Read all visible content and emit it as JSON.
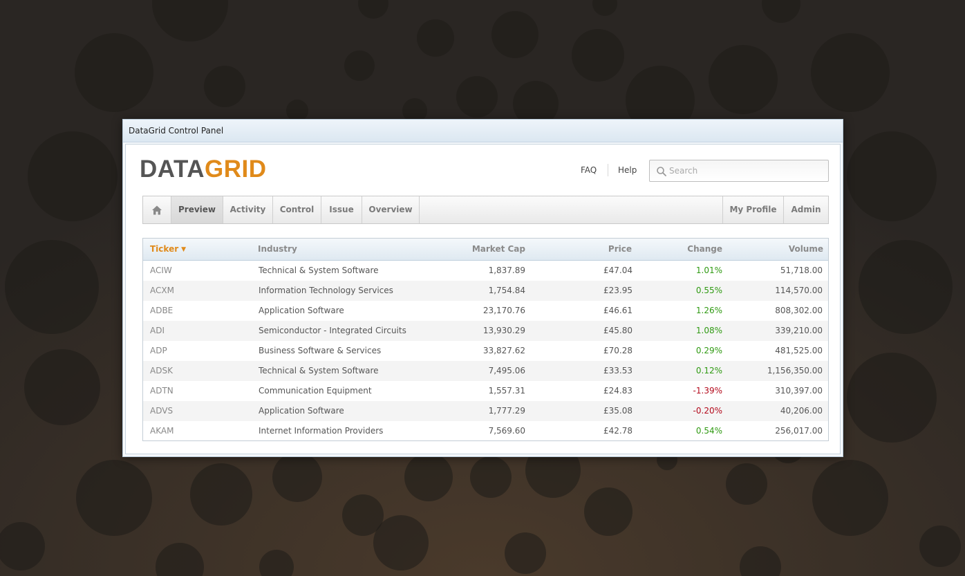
{
  "window": {
    "title": "DataGrid Control Panel"
  },
  "logo": {
    "part1": "DATA",
    "part2": "GRID"
  },
  "header_links": {
    "faq": "FAQ",
    "help": "Help"
  },
  "search": {
    "placeholder": "Search",
    "value": ""
  },
  "nav": {
    "home_icon": "home-icon",
    "left_items": [
      "Preview",
      "Activity",
      "Control",
      "Issue",
      "Overview"
    ],
    "active": "Preview",
    "right_items": [
      "My Profile",
      "Admin"
    ]
  },
  "grid": {
    "sorted_column": "Ticker",
    "sort_direction": "descending",
    "columns": {
      "ticker": "Ticker",
      "industry": "Industry",
      "market_cap": "Market Cap",
      "price": "Price",
      "change": "Change",
      "volume": "Volume"
    },
    "rows": [
      {
        "ticker": "ACIW",
        "industry": "Technical & System Software",
        "market_cap": "1,837.89",
        "price": "£47.04",
        "change": "1.01%",
        "volume": "51,718.00"
      },
      {
        "ticker": "ACXM",
        "industry": "Information Technology Services",
        "market_cap": "1,754.84",
        "price": "£23.95",
        "change": "0.55%",
        "volume": "114,570.00"
      },
      {
        "ticker": "ADBE",
        "industry": "Application Software",
        "market_cap": "23,170.76",
        "price": "£46.61",
        "change": "1.26%",
        "volume": "808,302.00"
      },
      {
        "ticker": "ADI",
        "industry": "Semiconductor - Integrated Circuits",
        "market_cap": "13,930.29",
        "price": "£45.80",
        "change": "1.08%",
        "volume": "339,210.00"
      },
      {
        "ticker": "ADP",
        "industry": "Business Software & Services",
        "market_cap": "33,827.62",
        "price": "£70.28",
        "change": "0.29%",
        "volume": "481,525.00"
      },
      {
        "ticker": "ADSK",
        "industry": "Technical & System Software",
        "market_cap": "7,495.06",
        "price": "£33.53",
        "change": "0.12%",
        "volume": "1,156,350.00"
      },
      {
        "ticker": "ADTN",
        "industry": "Communication Equipment",
        "market_cap": "1,557.31",
        "price": "£24.83",
        "change": "-1.39%",
        "volume": "310,397.00"
      },
      {
        "ticker": "ADVS",
        "industry": "Application Software",
        "market_cap": "1,777.29",
        "price": "£35.08",
        "change": "-0.20%",
        "volume": "40,206.00"
      },
      {
        "ticker": "AKAM",
        "industry": "Internet Information Providers",
        "market_cap": "7,569.60",
        "price": "£42.78",
        "change": "0.54%",
        "volume": "256,017.00"
      }
    ]
  },
  "colors": {
    "accent": "#e08a1a",
    "positive": "#2f9a12",
    "negative": "#b3091b",
    "background": "#2b2723"
  }
}
